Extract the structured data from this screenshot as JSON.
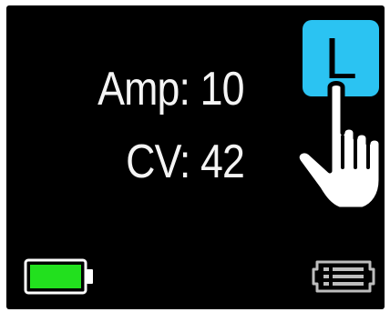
{
  "readouts": {
    "amp": "Amp: 10",
    "cv": "CV: 42"
  },
  "mode_button": {
    "label": "L"
  },
  "icons": {
    "battery": "battery-full-icon",
    "hand": "pointing-hand-icon",
    "menu": "list-menu-icon"
  },
  "battery": {
    "level": 1.0
  },
  "colors": {
    "screen_background": "#000000",
    "text": "#f4f4f4",
    "mode_button": "#2bc3f2",
    "battery_fill": "#22e01e"
  }
}
